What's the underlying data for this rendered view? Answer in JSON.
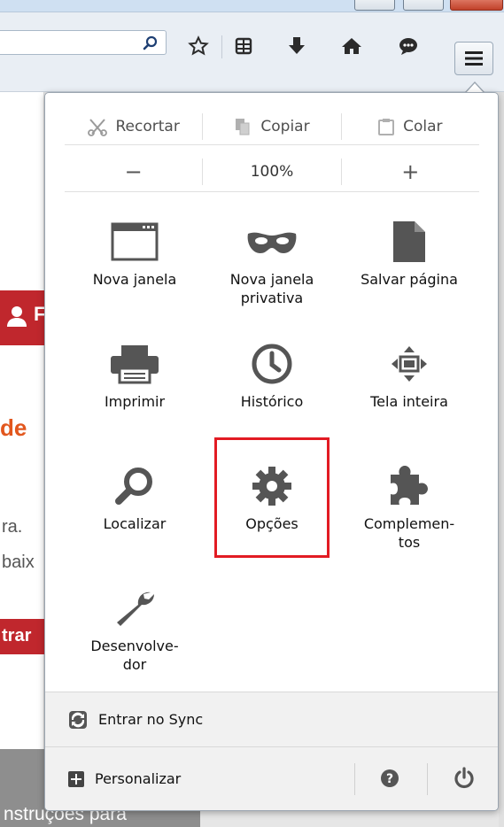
{
  "toolbar": {
    "icons": [
      "search-icon",
      "star-icon",
      "reading-list-icon",
      "download-icon",
      "home-icon",
      "chat-icon",
      "hamburger-menu-icon"
    ]
  },
  "background_page": {
    "avatar_letter": "F",
    "heading_fragment": "de",
    "line1": "ra.",
    "line2": "baix",
    "button_fragment": "trar",
    "caption": "nstruções para"
  },
  "menu": {
    "edit": {
      "cut": "Recortar",
      "copy": "Copiar",
      "paste": "Colar"
    },
    "zoom": {
      "minus": "−",
      "level": "100%",
      "plus": "+"
    },
    "items": [
      {
        "label": "Nova janela",
        "icon": "new-window-icon"
      },
      {
        "label": "Nova janela privativa",
        "icon": "private-mask-icon"
      },
      {
        "label": "Salvar página",
        "icon": "save-page-icon"
      },
      {
        "label": "Imprimir",
        "icon": "printer-icon"
      },
      {
        "label": "Histórico",
        "icon": "history-clock-icon"
      },
      {
        "label": "Tela inteira",
        "icon": "fullscreen-icon"
      },
      {
        "label": "Localizar",
        "icon": "find-magnifier-icon"
      },
      {
        "label": "Opções",
        "icon": "options-gear-icon"
      },
      {
        "label": "Complemen-tos",
        "icon": "addons-puzzle-icon"
      },
      {
        "label": "Desenvolve-dor",
        "icon": "developer-wrench-icon"
      }
    ],
    "sync": {
      "label": "Entrar no Sync"
    },
    "customize": {
      "label": "Personalizar"
    }
  },
  "colors": {
    "highlight": "#e21b23",
    "brand_red": "#c0272d",
    "accent_orange": "#e2571e"
  }
}
